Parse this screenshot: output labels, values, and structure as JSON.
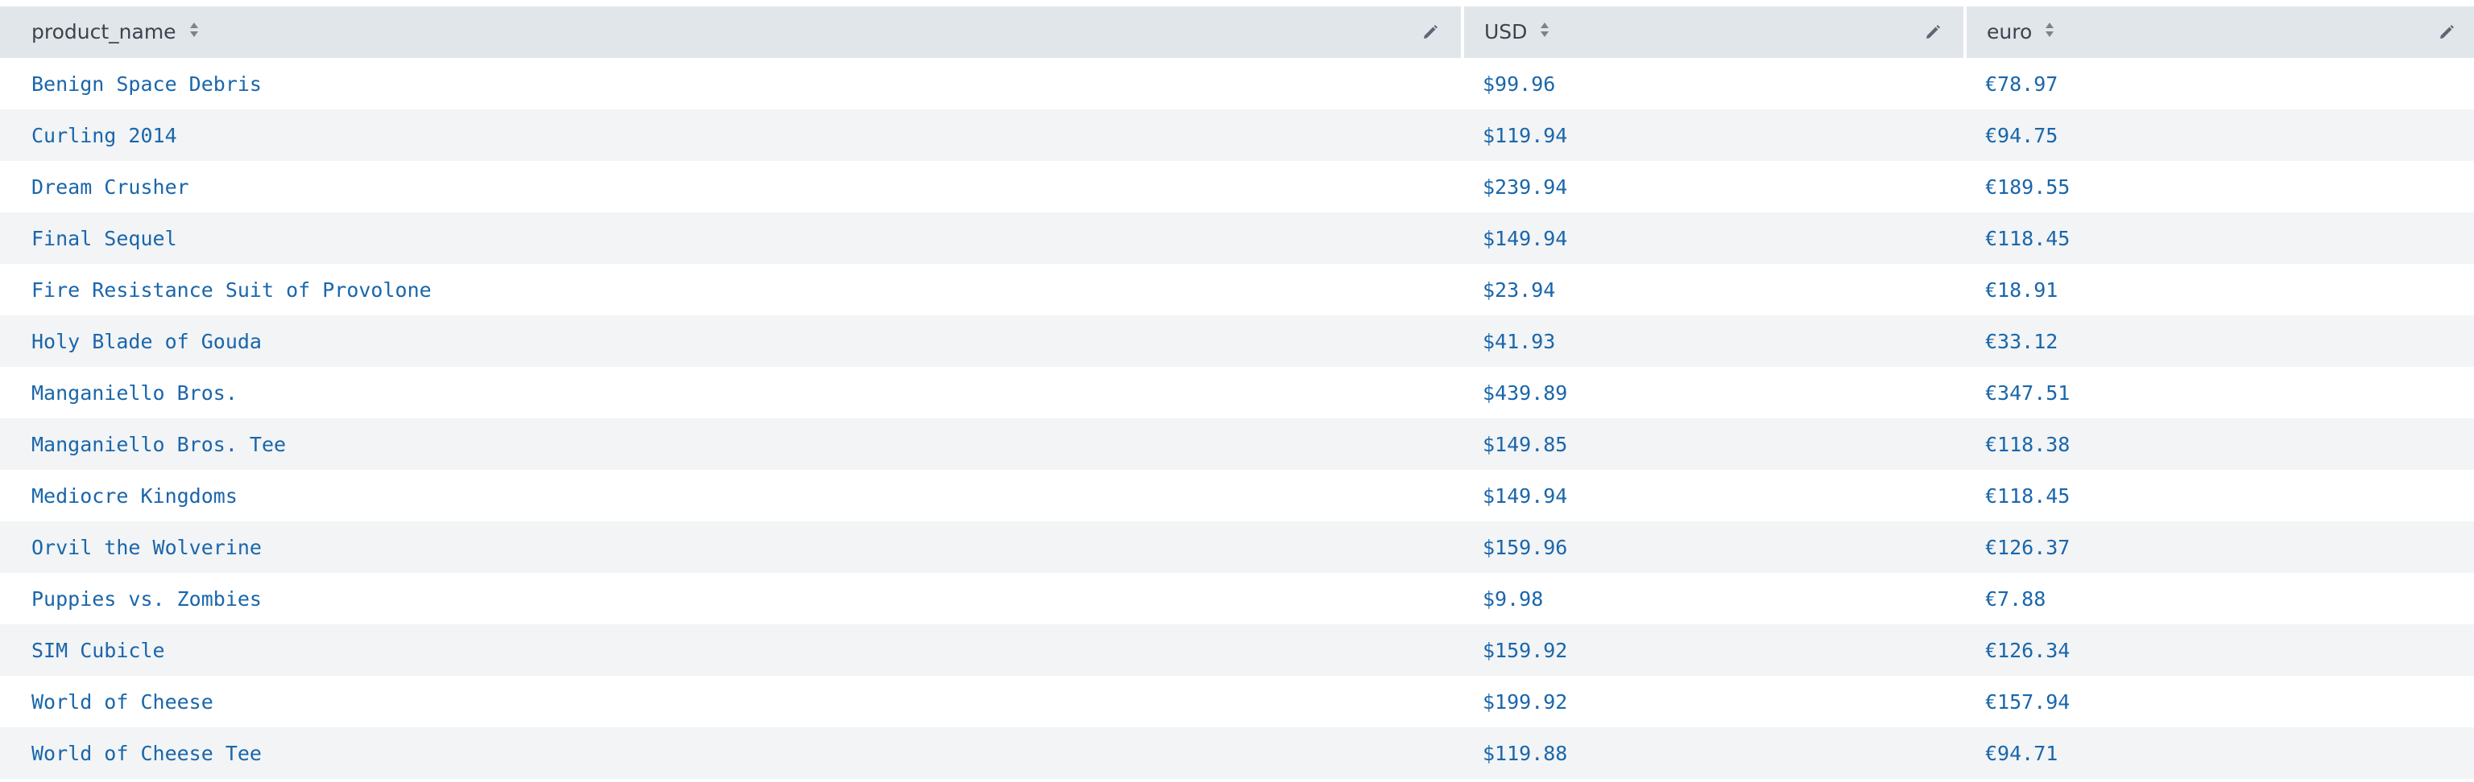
{
  "table": {
    "columns": [
      {
        "label": "product_name"
      },
      {
        "label": "USD"
      },
      {
        "label": "euro"
      }
    ],
    "rows": [
      {
        "product_name": "Benign Space Debris",
        "usd": "$99.96",
        "euro": "€78.97"
      },
      {
        "product_name": "Curling 2014",
        "usd": "$119.94",
        "euro": "€94.75"
      },
      {
        "product_name": "Dream Crusher",
        "usd": "$239.94",
        "euro": "€189.55"
      },
      {
        "product_name": "Final Sequel",
        "usd": "$149.94",
        "euro": "€118.45"
      },
      {
        "product_name": "Fire Resistance Suit of Provolone",
        "usd": "$23.94",
        "euro": "€18.91"
      },
      {
        "product_name": "Holy Blade of Gouda",
        "usd": "$41.93",
        "euro": "€33.12"
      },
      {
        "product_name": "Manganiello Bros.",
        "usd": "$439.89",
        "euro": "€347.51"
      },
      {
        "product_name": "Manganiello Bros. Tee",
        "usd": "$149.85",
        "euro": "€118.38"
      },
      {
        "product_name": "Mediocre Kingdoms",
        "usd": "$149.94",
        "euro": "€118.45"
      },
      {
        "product_name": "Orvil the Wolverine",
        "usd": "$159.96",
        "euro": "€126.37"
      },
      {
        "product_name": "Puppies vs. Zombies",
        "usd": "$9.98",
        "euro": "€7.88"
      },
      {
        "product_name": "SIM Cubicle",
        "usd": "$159.92",
        "euro": "€126.34"
      },
      {
        "product_name": "World of Cheese",
        "usd": "$199.92",
        "euro": "€157.94"
      },
      {
        "product_name": "World of Cheese Tee",
        "usd": "$119.88",
        "euro": "€94.71"
      }
    ]
  },
  "colors": {
    "header_bg": "#e1e6eb",
    "header_text": "#3c444d",
    "cell_link": "#1a66ab",
    "row_stripe": "#f2f4f5"
  },
  "icons": {
    "sort": "sort-icon",
    "edit": "pencil-icon"
  }
}
